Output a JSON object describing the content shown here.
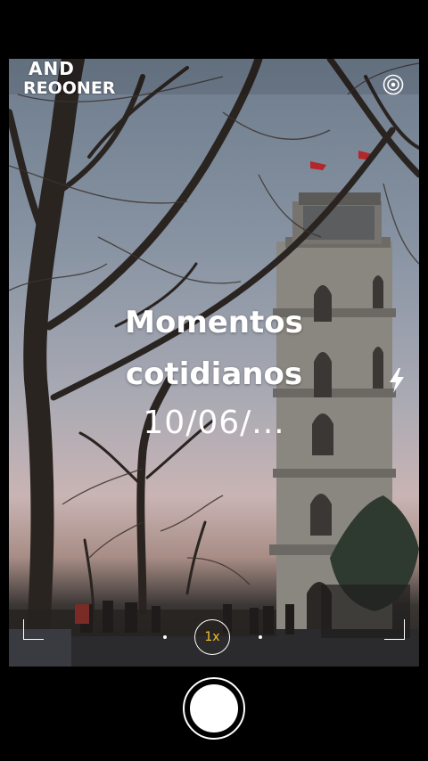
{
  "brand": {
    "line1": "AND",
    "line2": "REOONER"
  },
  "overlay": {
    "title_line1": "Momentos",
    "title_line2": "cotidianos",
    "date": "10/06/..."
  },
  "zoom": {
    "label": "1x"
  },
  "icons": {
    "settings": "settings-target-icon",
    "flash": "lightning-bolt-icon",
    "shutter": "shutter-button"
  },
  "colors": {
    "zoom_text": "#f2c230",
    "background": "#000000",
    "overlay_text": "#ffffff"
  }
}
